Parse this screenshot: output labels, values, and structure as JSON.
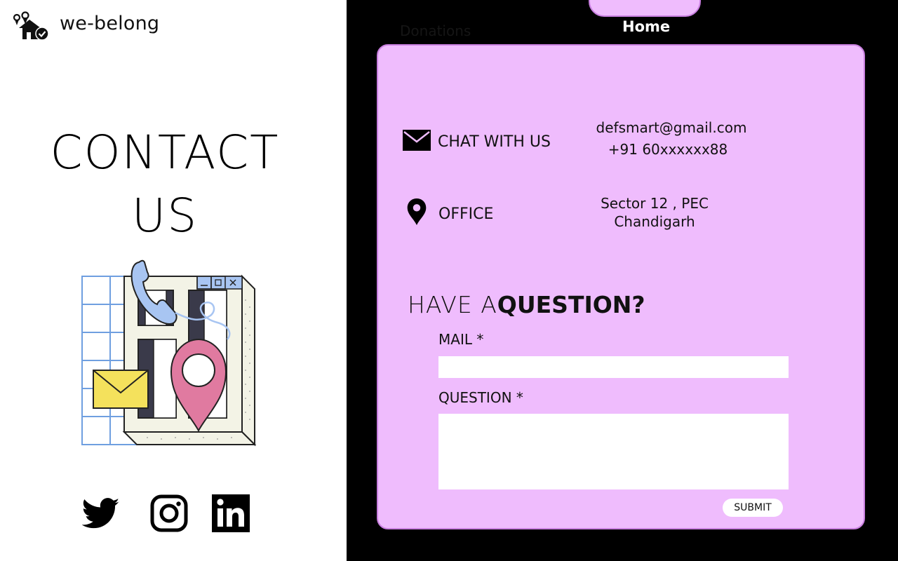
{
  "brand": {
    "name": "we-belong"
  },
  "hero": {
    "line1": "CONTACT",
    "line2": "US"
  },
  "social": [
    {
      "name": "twitter-icon"
    },
    {
      "name": "instagram-icon"
    },
    {
      "name": "linkedin-icon"
    }
  ],
  "nav": {
    "donations": "Donations",
    "home": "Home"
  },
  "contact": {
    "chat_label": "CHAT WITH US",
    "email": "defsmart@gmail.com",
    "phone": "+91 60xxxxxx88",
    "office_label": "OFFICE",
    "address_line1": "Sector 12 , PEC",
    "address_line2": "Chandigarh"
  },
  "form": {
    "title_light": "HAVE A",
    "title_bold": "QUESTION?",
    "mail_label": "MAIL *",
    "mail_value": "",
    "question_label": "QUESTION *",
    "question_value": "",
    "submit_label": "SUBMIT"
  },
  "colors": {
    "accent": "#efbcfd",
    "accent_border": "#c97fe0",
    "panel_bg": "#000000"
  }
}
